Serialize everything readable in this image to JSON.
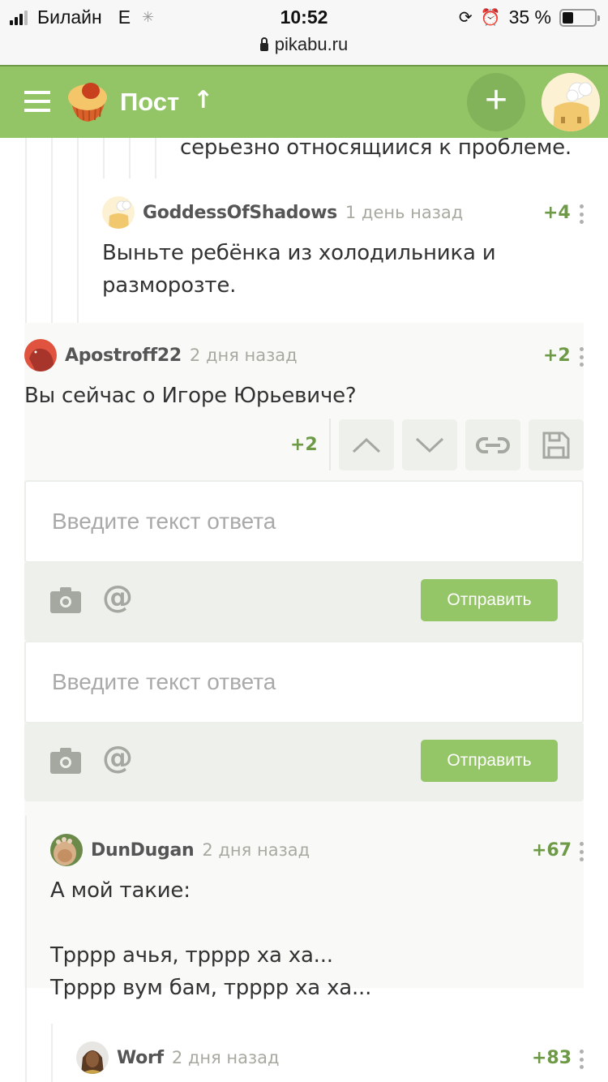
{
  "status_bar": {
    "carrier": "Билайн",
    "network": "E",
    "time": "10:52",
    "battery": "35 %",
    "battery_level": 0.35
  },
  "browser": {
    "url": "pikabu.ru"
  },
  "header": {
    "title": "Пост",
    "up_arrow": "↑",
    "add_label": "+",
    "brand_color": "#93c566"
  },
  "comments": {
    "cut_text": "серьезно относящиися к проблеме.",
    "goddess": {
      "author": "GoddessOfShadows",
      "time": "1 день назад",
      "rating": "+4",
      "text": "Выньте ребёнка из холодильника и разморозте."
    },
    "apostroff": {
      "author": "Apostroff22",
      "time": "2 дня назад",
      "rating": "+2",
      "text": "Вы сейчас о Игоре Юрьевиче?",
      "action_rating": "+2"
    },
    "dundugan": {
      "author": "DunDugan",
      "time": "2 дня назад",
      "rating": "+67",
      "lines": [
        "А мой такие:",
        "",
        "Трррр ачья, трррр ха ха...",
        "Трррр вум бам, трррр ха ха..."
      ]
    },
    "worf": {
      "author": "Worf",
      "time": "2 дня назад",
      "rating": "+83"
    }
  },
  "reply_forms": [
    {
      "placeholder": "Введите текст ответа",
      "value": "",
      "send_label": "Отправить"
    },
    {
      "placeholder": "Введите текст ответа",
      "value": "",
      "send_label": "Отправить"
    }
  ],
  "colors": {
    "rating_positive": "#6e9a48",
    "send_button": "#94c566"
  }
}
